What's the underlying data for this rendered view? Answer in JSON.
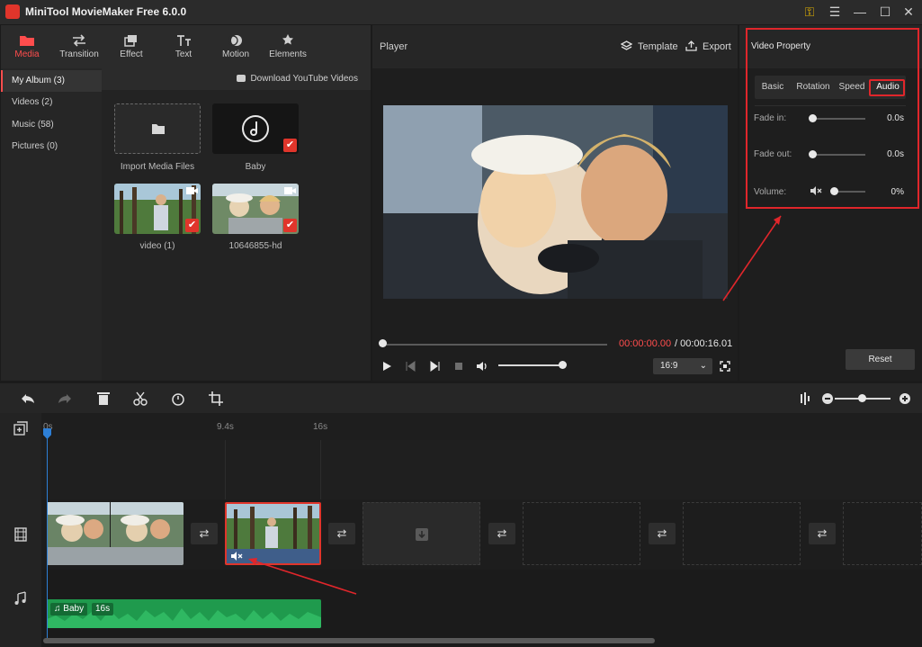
{
  "app": {
    "title": "MiniTool MovieMaker Free 6.0.0"
  },
  "toolbar": {
    "tabs": [
      {
        "label": "Media",
        "icon": "folder-icon",
        "active": true
      },
      {
        "label": "Transition",
        "icon": "swap-icon"
      },
      {
        "label": "Effect",
        "icon": "layers-icon"
      },
      {
        "label": "Text",
        "icon": "text-icon"
      },
      {
        "label": "Motion",
        "icon": "motion-icon"
      },
      {
        "label": "Elements",
        "icon": "elements-icon"
      }
    ]
  },
  "album": {
    "items": [
      {
        "label": "My Album (3)",
        "active": true
      },
      {
        "label": "Videos (2)"
      },
      {
        "label": "Music (58)"
      },
      {
        "label": "Pictures (0)"
      }
    ],
    "download_label": "Download YouTube Videos"
  },
  "media": [
    {
      "label": "Import Media Files"
    },
    {
      "label": "Baby"
    },
    {
      "label": "video (1)"
    },
    {
      "label": "10646855-hd"
    }
  ],
  "player": {
    "title": "Player",
    "template_label": "Template",
    "export_label": "Export",
    "time_current": "00:00:00.00",
    "time_total": "/ 00:00:16.01",
    "aspect": "16:9",
    "volume": 0.95,
    "progress": 0
  },
  "property": {
    "title": "Video Property",
    "tabs": [
      "Basic",
      "Rotation",
      "Speed",
      "Audio"
    ],
    "active_tab": "Audio",
    "fade_in": {
      "label": "Fade in:",
      "value": "0.0s"
    },
    "fade_out": {
      "label": "Fade out:",
      "value": "0.0s"
    },
    "volume": {
      "label": "Volume:",
      "value": "0%"
    },
    "reset_label": "Reset"
  },
  "timeline": {
    "ticks": [
      "0s",
      "9.4s",
      "16s"
    ],
    "audio_clip": {
      "name": "Baby",
      "duration": "16s"
    },
    "zoom": 0.5
  },
  "colors": {
    "accent": "#e0352b",
    "highlight": "#e0262b",
    "audio": "#1f9a4d",
    "playhead": "#2d7fd6"
  }
}
